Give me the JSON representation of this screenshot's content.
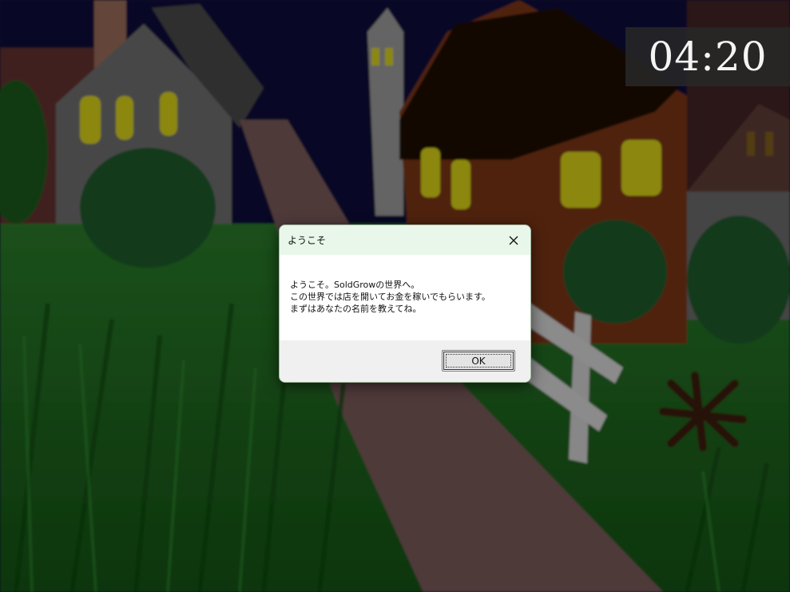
{
  "hud": {
    "clock": "04:20"
  },
  "dialog": {
    "title": "ようこそ",
    "message_lines": [
      "ようこそ。SoldGrowの世界へ。",
      "この世界では店を開いてお金を稼いでもらいます。",
      "まずはあなたの名前を教えてね。"
    ],
    "ok_label": "OK",
    "close_icon": "close-icon"
  },
  "scene": {
    "description_icons": [
      "house",
      "road",
      "fence",
      "bush"
    ],
    "colors": {
      "sky": "#0d0d3a",
      "grass": "#1f6a1f",
      "road": "#7a5a5a",
      "house_brown": "#6b2f14",
      "house_gray": "#7a7a7a",
      "window": "#d8d018"
    }
  }
}
